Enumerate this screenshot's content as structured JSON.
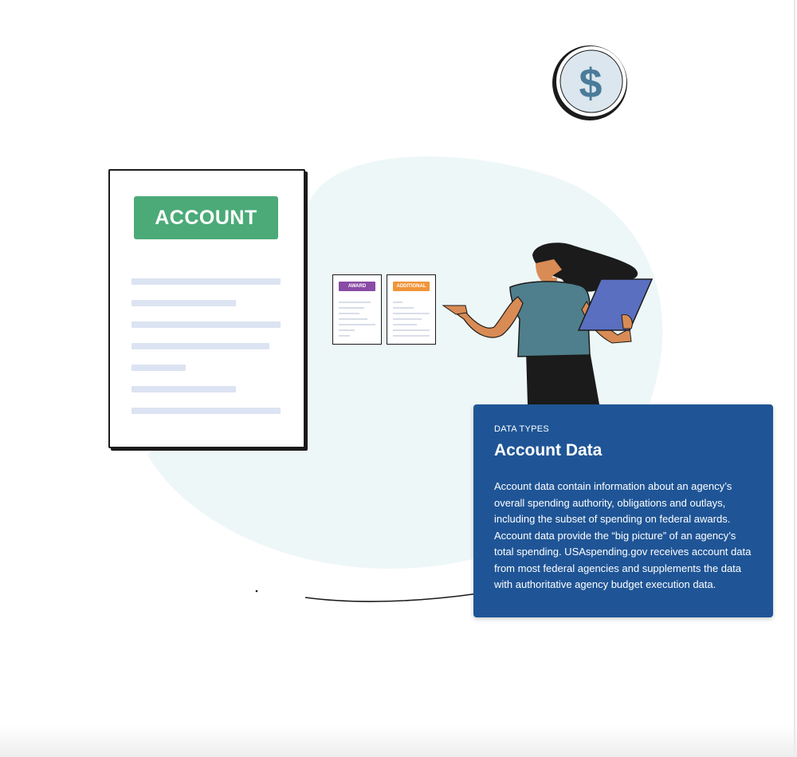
{
  "illustration": {
    "account_label": "ACCOUNT",
    "mini_docs": [
      {
        "label": "AWARD",
        "color": "#8a4ba6"
      },
      {
        "label": "ADDITIONAL",
        "color": "#f0953a"
      }
    ],
    "coin_symbol": "$",
    "colors": {
      "account_badge": "#4baa78",
      "blob": "#eef7f7",
      "shirt": "#4f7f8c",
      "skin": "#d98b55",
      "clipboard": "#5a6fbf"
    }
  },
  "card": {
    "eyebrow": "DATA TYPES",
    "title": "Account Data",
    "body": "Account data contain information about an agency’s overall spending authority, obligations and outlays, including the subset of spending on federal awards. Account data provide the “big picture” of an agency’s total spending. USAspending.gov receives account data from most federal agencies and supplements the data with authoritative agency budget execution data.",
    "background": "#1f5596"
  }
}
